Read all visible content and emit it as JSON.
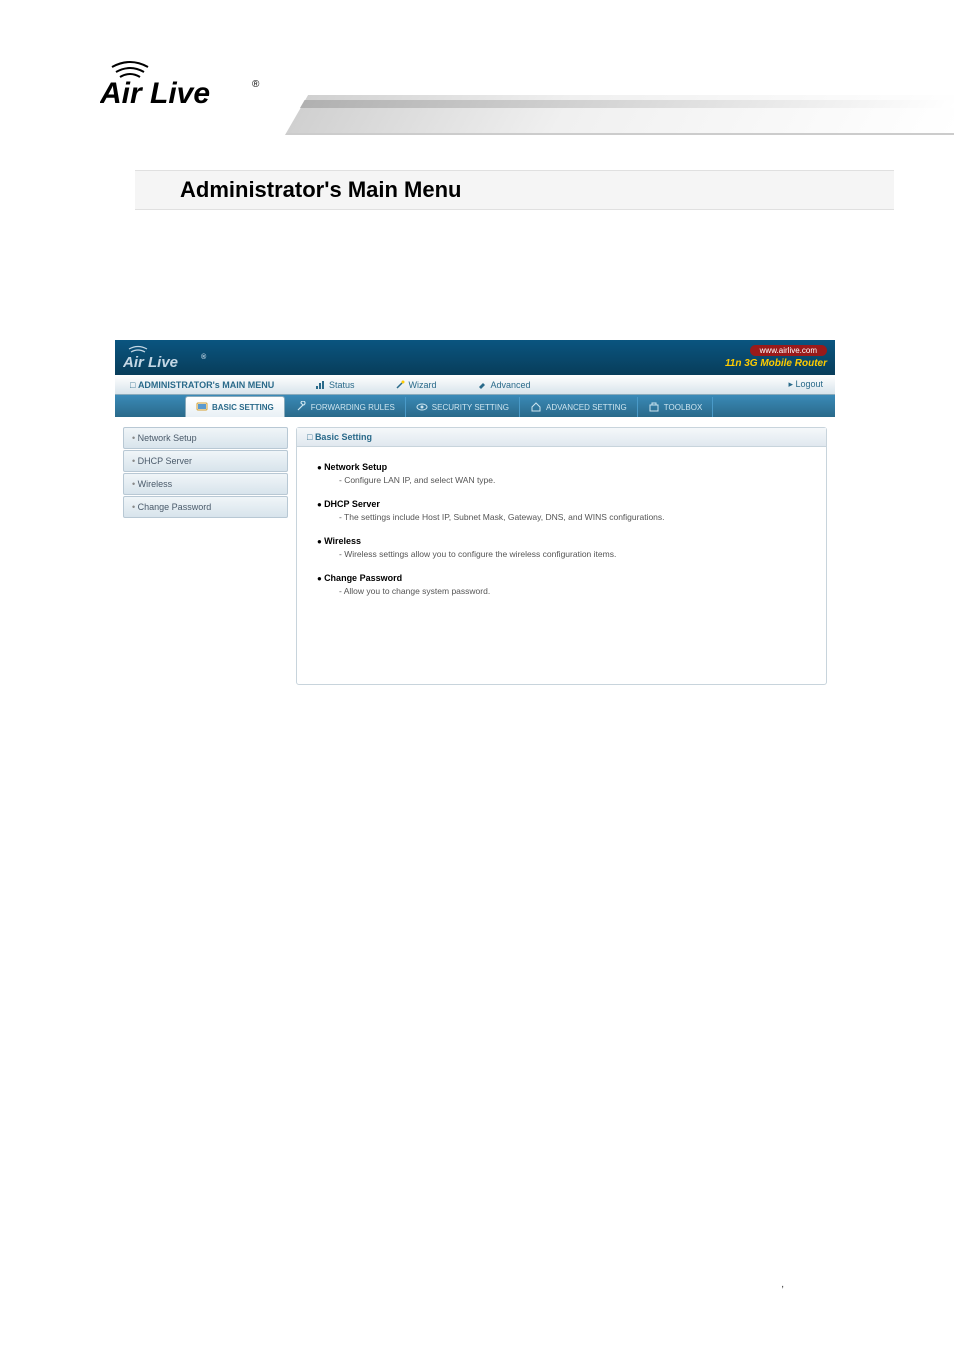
{
  "logo_text": "Air Live",
  "logo_reg": "®",
  "page_title": "Administrator's Main Menu",
  "router": {
    "logo": "Air Live",
    "url_badge": "www.airlive.com",
    "tagline": "11n 3G Mobile Router",
    "menubar": {
      "admin_label": "ADMINISTRATOR's MAIN MENU",
      "items": [
        {
          "label": "Status",
          "icon": "bars-icon"
        },
        {
          "label": "Wizard",
          "icon": "wand-icon"
        },
        {
          "label": "Advanced",
          "icon": "tools-icon"
        }
      ],
      "logout": "▸ Logout"
    },
    "tabs": [
      {
        "label": "BASIC SETTING",
        "active": true
      },
      {
        "label": "FORWARDING RULES",
        "active": false
      },
      {
        "label": "SECURITY SETTING",
        "active": false
      },
      {
        "label": "ADVANCED SETTING",
        "active": false
      },
      {
        "label": "TOOLBOX",
        "active": false
      }
    ],
    "sidebar": [
      {
        "label": "Network Setup"
      },
      {
        "label": "DHCP Server"
      },
      {
        "label": "Wireless"
      },
      {
        "label": "Change Password"
      }
    ],
    "panel": {
      "title": "Basic Setting",
      "items": [
        {
          "title": "Network Setup",
          "desc": "- Configure LAN IP, and select WAN type."
        },
        {
          "title": "DHCP Server",
          "desc": "- The settings include Host IP, Subnet Mask, Gateway, DNS, and WINS configurations."
        },
        {
          "title": "Wireless",
          "desc": "- Wireless settings allow you to configure the wireless configuration items."
        },
        {
          "title": "Change Password",
          "desc": "- Allow you to change system password."
        }
      ]
    }
  },
  "footer_mark": ","
}
